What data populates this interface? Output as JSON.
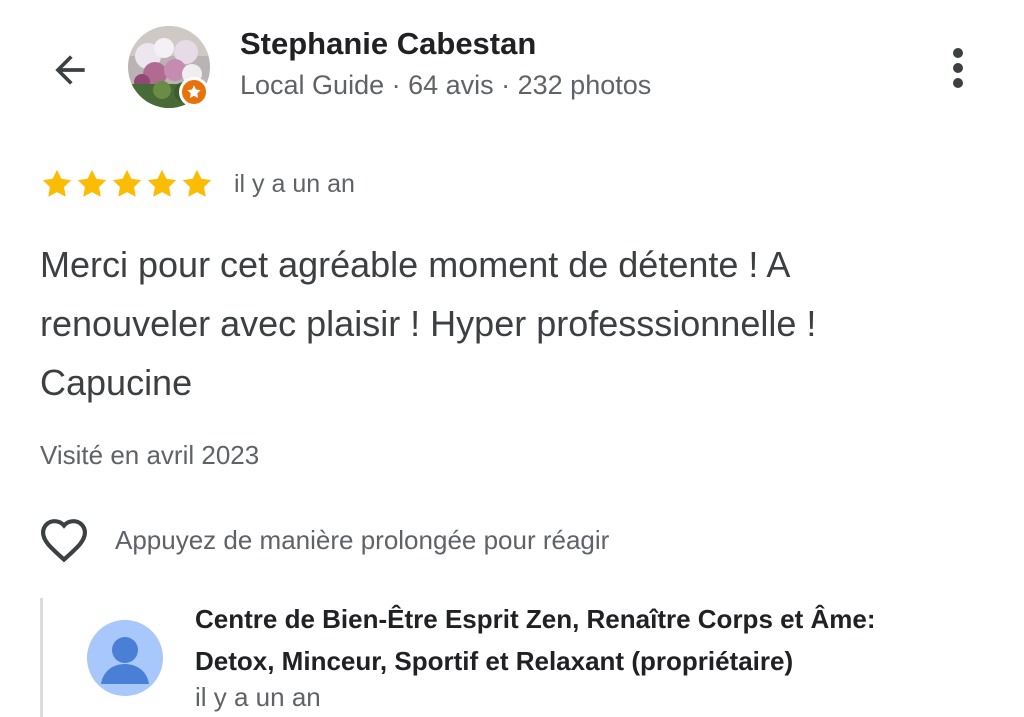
{
  "header": {
    "reviewer_name": "Stephanie Cabestan",
    "reviewer_subline": "Local Guide · 64 avis · 232 photos"
  },
  "review": {
    "rating": 5,
    "rating_max": 5,
    "time": "il y a un an",
    "text": "Merci pour cet agréable moment de détente ! A renouveler avec plaisir ! Hyper professsionnelle ! Capucine",
    "visited": "Visité en avril 2023"
  },
  "reaction": {
    "label": "Appuyez de manière prolongée pour réagir"
  },
  "owner_reply": {
    "owner_name": "Centre de Bien-Être Esprit Zen, Renaître Corps et Âme: Detox, Minceur, Sportif et Relaxant (propriétaire)",
    "time": "il y a un an"
  },
  "colors": {
    "star": "#fbbc04",
    "local_guide_badge": "#e8710a",
    "owner_avatar_bg": "#a8c7fa",
    "owner_avatar_fg": "#4a7fd6"
  },
  "icons": {
    "back": "arrow-left-icon",
    "more": "more-vertical-icon",
    "reaction": "heart-outline-icon",
    "badge": "local-guide-star-icon"
  }
}
